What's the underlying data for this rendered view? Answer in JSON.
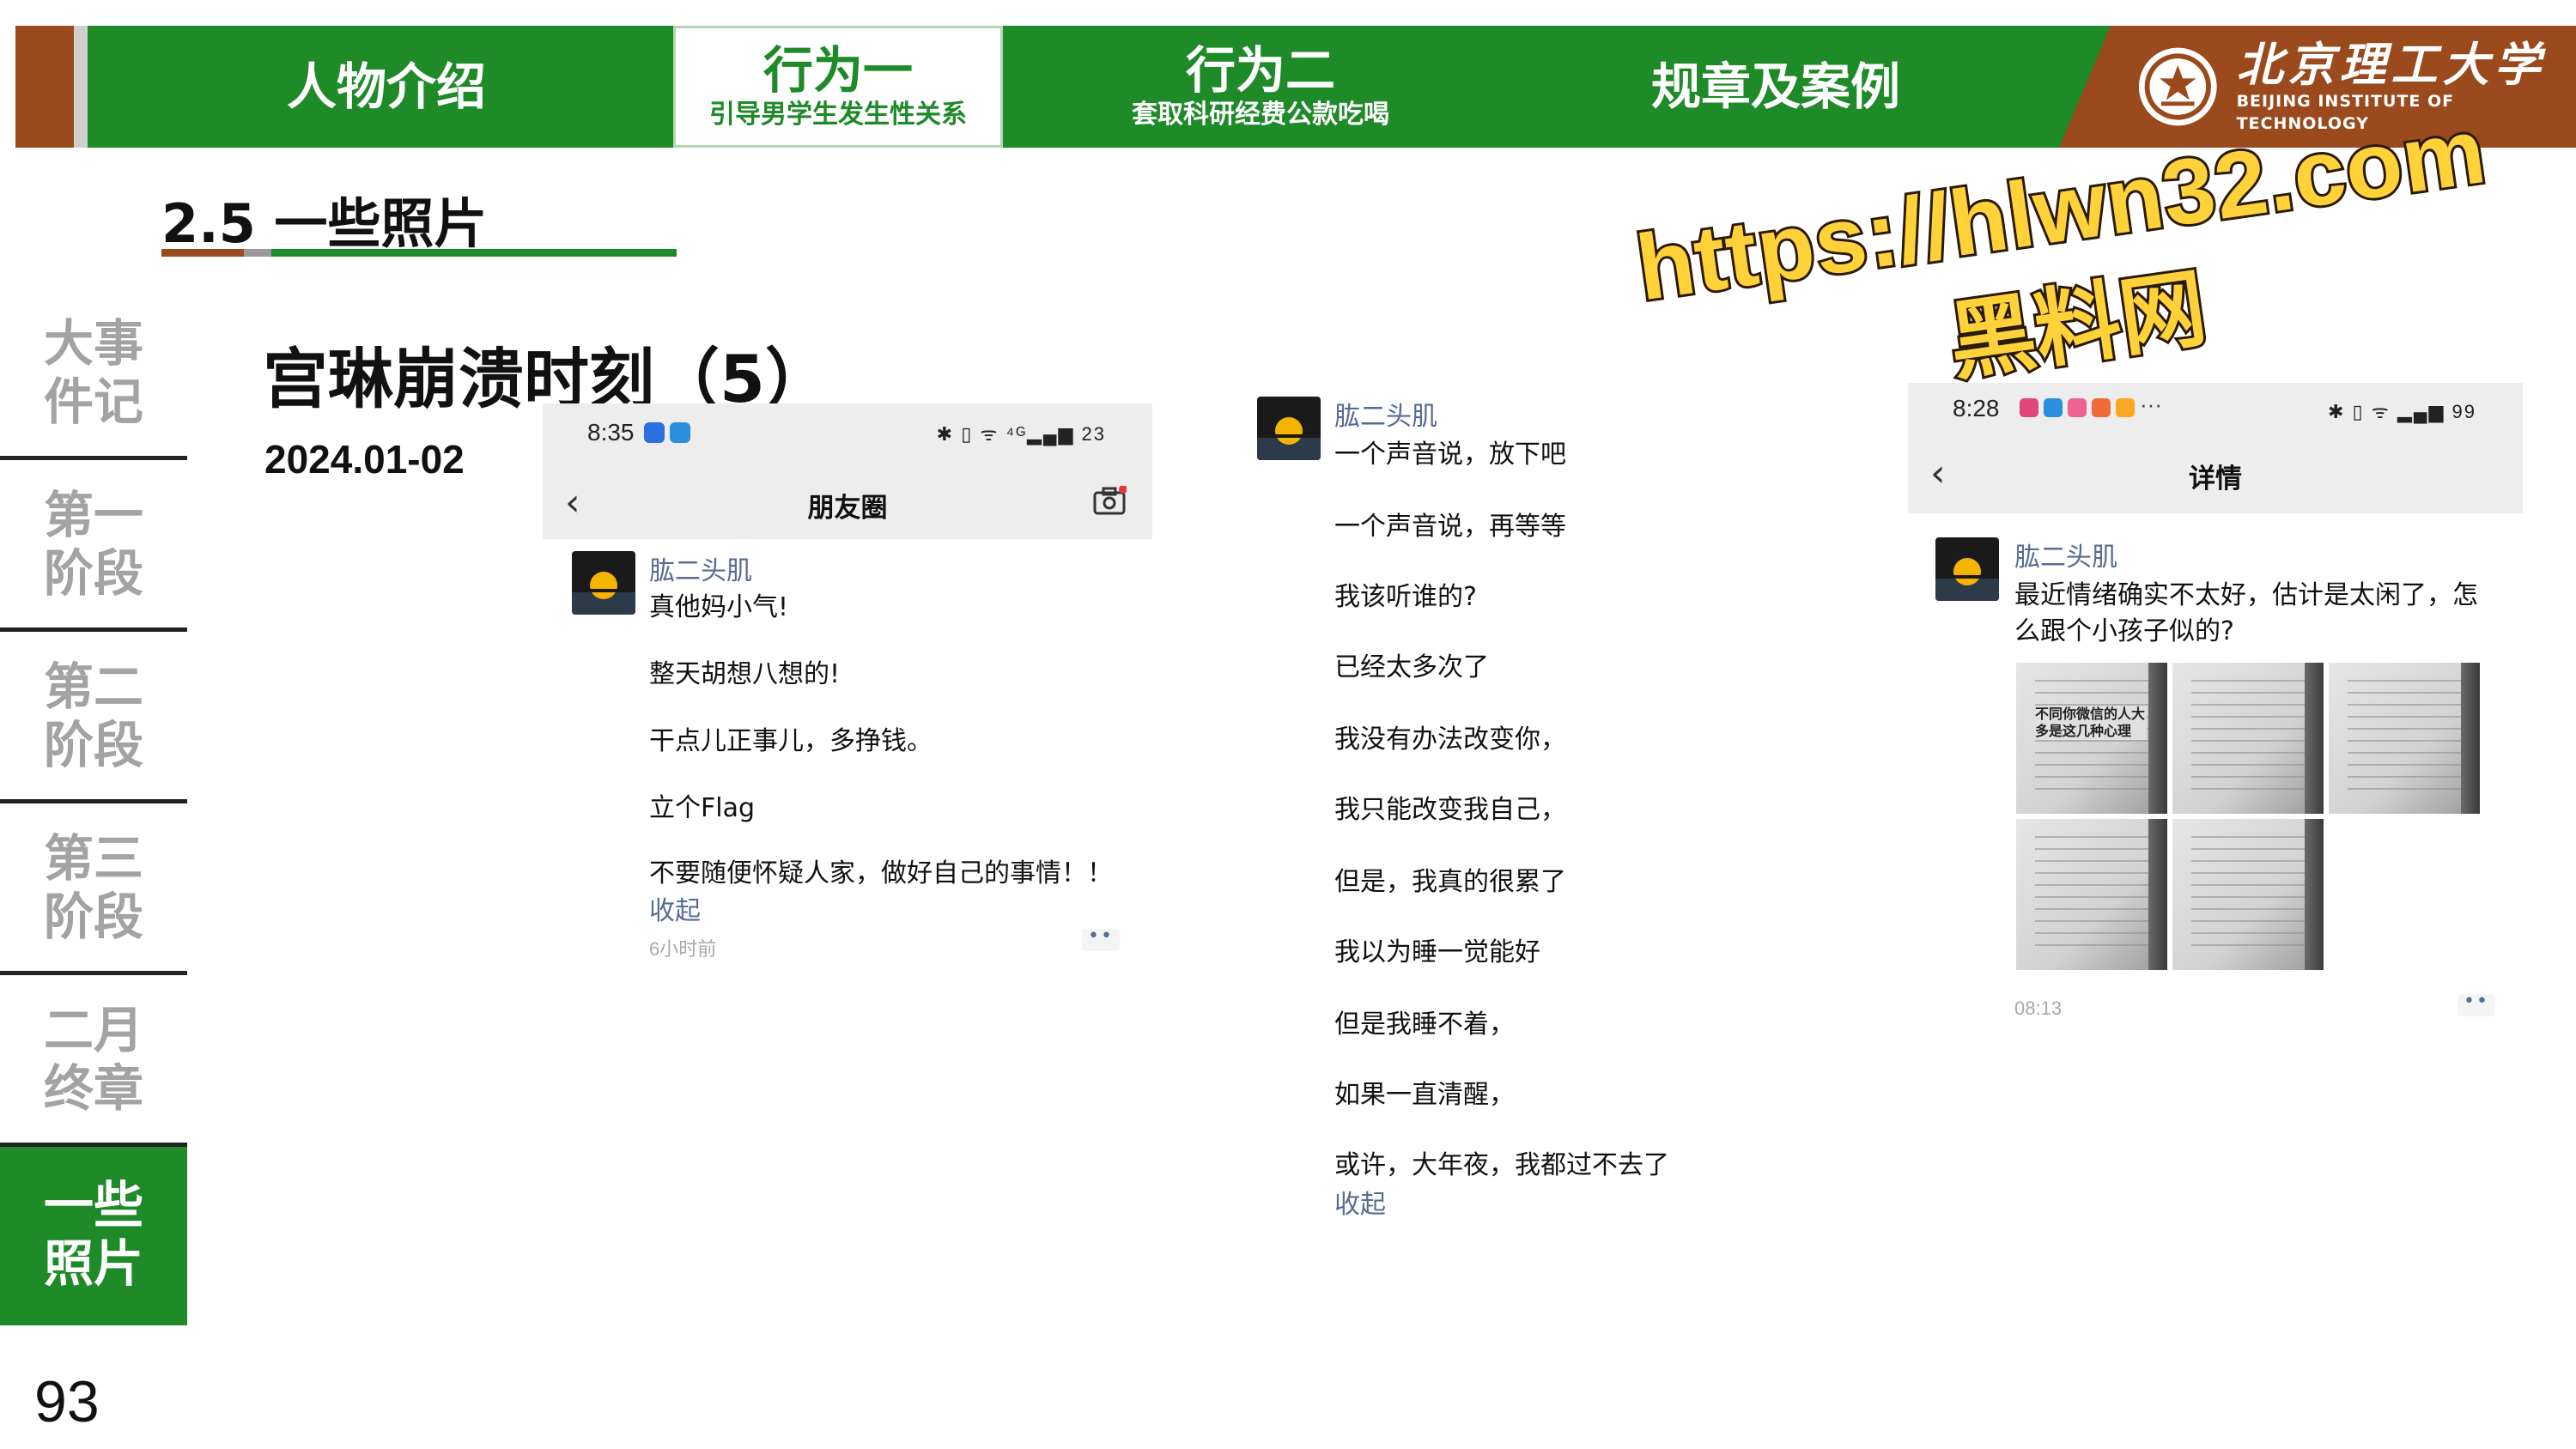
{
  "colors": {
    "accent_green": "#1e8a28",
    "accent_brown": "#9a4a1c",
    "link_blue": "#576b95",
    "watermark_yellow": "#ffd23a"
  },
  "top_nav": {
    "tabs": [
      {
        "title": "人物介绍",
        "subtitle": ""
      },
      {
        "title": "行为一",
        "subtitle": "引导男学生发生性关系"
      },
      {
        "title": "行为二",
        "subtitle": "套取科研经费公款吃喝"
      },
      {
        "title": "规章及案例",
        "subtitle": ""
      }
    ],
    "logo": {
      "cn": "北京理工大学",
      "en": "BEIJING INSTITUTE OF TECHNOLOGY",
      "icon": "university-emblem-icon"
    }
  },
  "section": {
    "title": "2.5 一些照片"
  },
  "sidebar": {
    "items": [
      {
        "label": "大事件记"
      },
      {
        "label": "第一阶段"
      },
      {
        "label": "第二阶段"
      },
      {
        "label": "第三阶段"
      },
      {
        "label": "二月终章"
      },
      {
        "label": "一些照片"
      }
    ],
    "active_index": 5
  },
  "page_number": "93",
  "slide": {
    "heading": "宫琳崩溃时刻（5）",
    "date": "2024.01-02"
  },
  "watermark": {
    "url": "https://hlwn32.com",
    "site": "黑料网"
  },
  "phone1": {
    "time": "8:35",
    "status_right": "✱ ▯ ᯤ ⁴ᴳ▂▄▆ 23",
    "title": "朋友圈",
    "back_icon": "chevron-left-icon",
    "camera_icon": "camera-icon",
    "user": "肱二头肌",
    "lines": [
      "真他妈小气!",
      "整天胡想八想的!",
      "干点儿正事儿，多挣钱。",
      "立个Flag",
      "不要随便怀疑人家，做好自己的事情！！"
    ],
    "collapse": "收起",
    "timestamp": "6小时前"
  },
  "phone2": {
    "user": "肱二头肌",
    "lines": [
      "一个声音说，放下吧",
      "一个声音说，再等等",
      "我该听谁的?",
      "已经太多次了",
      "我没有办法改变你，",
      "我只能改变我自己，",
      "但是，我真的很累了",
      "我以为睡一觉能好",
      "但是我睡不着，",
      "如果一直清醒，",
      "或许，大年夜，我都过不去了"
    ],
    "collapse": "收起"
  },
  "phone3": {
    "time": "8:28",
    "status_right": "✱ ▯ ᯤ ▂▄▆ 99",
    "title": "详情",
    "back_icon": "chevron-left-icon",
    "user": "肱二头肌",
    "lines": [
      "最近情绪确实不太好，估计是太闲了，怎",
      "么跟个小孩子似的?"
    ],
    "thumb_title": "不同你微信的人大多是这几种心理",
    "timestamp": "08:13"
  }
}
